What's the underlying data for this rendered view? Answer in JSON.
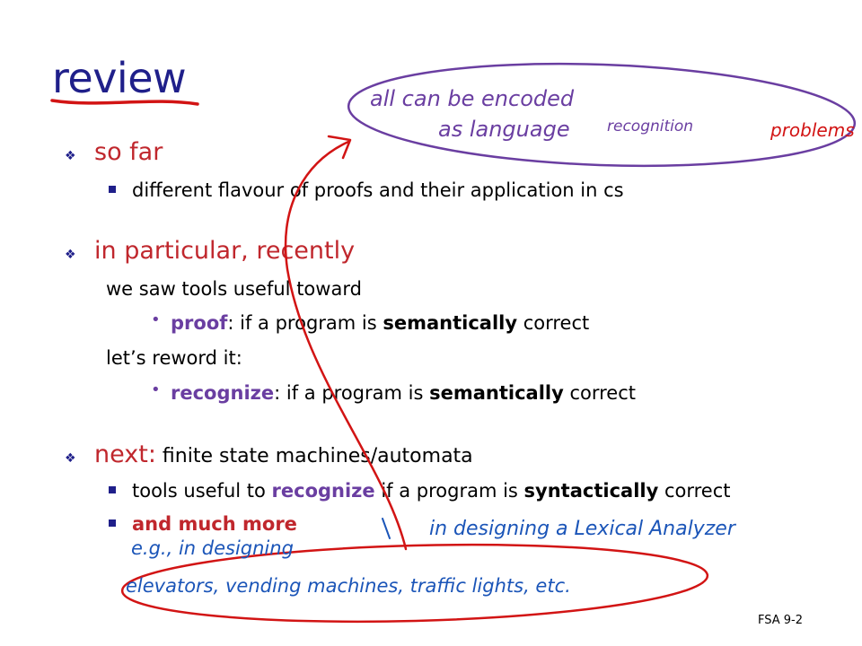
{
  "slide": {
    "title": "review",
    "footer": "FSA 9-2"
  },
  "sections": {
    "so_far": {
      "heading": "so far",
      "item1": "different flavour of proofs and their application in cs"
    },
    "particular": {
      "heading": "in particular, recently",
      "line1": "we saw tools useful toward",
      "bullet1_key": "proof",
      "bullet1_mid": ": if a program is ",
      "bullet1_bold": "semantically",
      "bullet1_end": " correct",
      "line2": "let’s reword it:",
      "bullet2_key": "recognize",
      "bullet2_mid": ": if a program is ",
      "bullet2_bold": "semantically",
      "bullet2_end": " correct"
    },
    "next": {
      "heading": "next:",
      "heading_rest": " finite state machines/automata",
      "item1_start": "tools useful to ",
      "item1_key": "recognize",
      "item1_mid": " if a program is ",
      "item1_bold": "syntactically",
      "item1_end": " correct",
      "item2": "and much more"
    }
  },
  "annotations": {
    "top_note_line1": "all can be encoded",
    "top_note_line2a": "as language",
    "top_note_line2b": "recognition",
    "top_note_line2c": "problems",
    "lexer_note": "in designing a Lexical Analyzer",
    "eg_note": "e.g., in designing",
    "examples_note": "elevators, vending machines, traffic lights, etc."
  },
  "colors": {
    "title": "#1f1f8a",
    "heading_red": "#c0272d",
    "keyword_purple": "#6a3ea1",
    "ink_blue": "#1b55b8",
    "ink_red": "#d21414",
    "ink_purple": "#6a3ea1"
  }
}
